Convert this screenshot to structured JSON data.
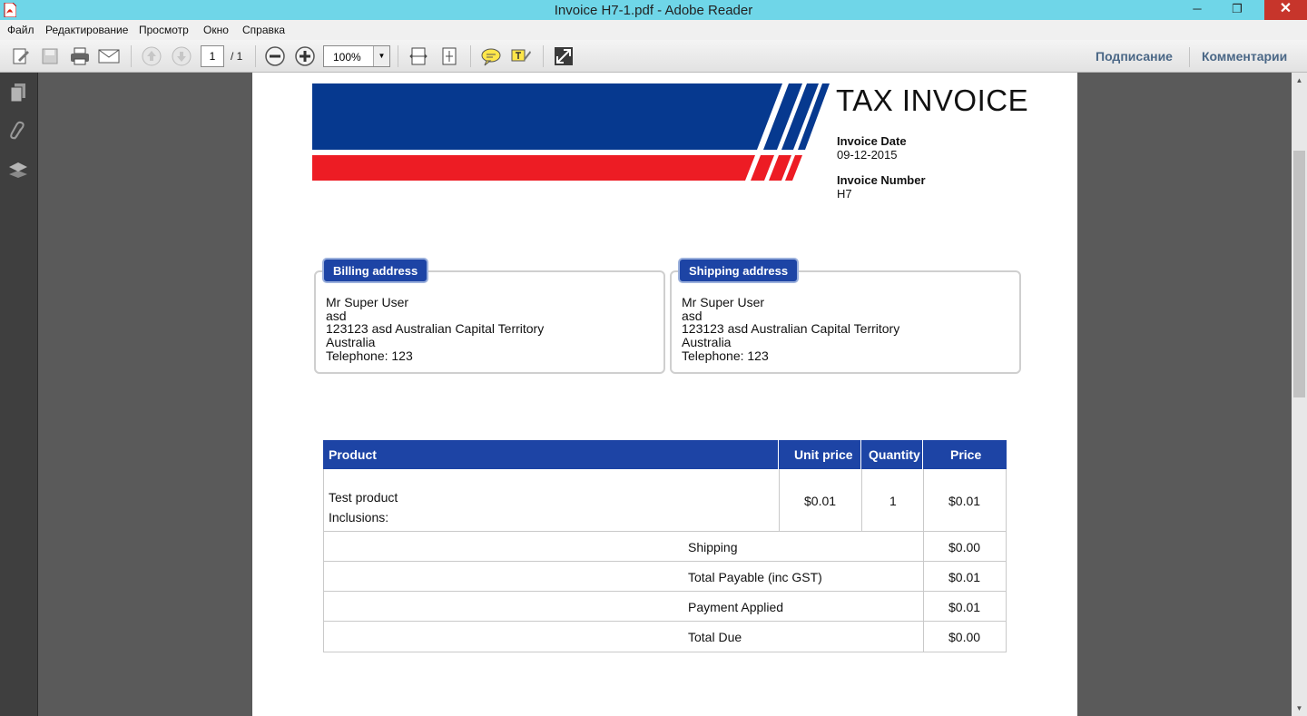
{
  "window": {
    "title": "Invoice H7-1.pdf - Adobe Reader",
    "restore_glyph": "❐",
    "minimize_glyph": "─",
    "close_glyph": "✕"
  },
  "menu": {
    "file": "Файл",
    "edit": "Редактирование",
    "view": "Просмотр",
    "window": "Окно",
    "help": "Справка"
  },
  "toolbar": {
    "page_current": "1",
    "page_total": "/ 1",
    "zoom": "100%",
    "sign_label": "Подписание",
    "comment_label": "Комментарии"
  },
  "colors": {
    "accent_blue": "#1d44a5",
    "banner_blue": "#06398f",
    "banner_red": "#ed1c24",
    "titlebar": "#6fd6e8"
  },
  "invoice": {
    "title": "TAX INVOICE",
    "date_label": "Invoice Date",
    "date_value": "09-12-2015",
    "number_label": "Invoice Number",
    "number_value": "H7",
    "billing": {
      "heading": "Billing address",
      "name": "Mr Super User",
      "line1": "asd",
      "line2": "123123 asd Australian Capital Territory",
      "country": "Australia",
      "phone": "Telephone: 123"
    },
    "shipping": {
      "heading": "Shipping address",
      "name": "Mr Super User",
      "line1": "asd",
      "line2": "123123 asd Australian Capital Territory",
      "country": "Australia",
      "phone": "Telephone: 123"
    },
    "table": {
      "headers": [
        "Product",
        "Unit price",
        "Quantity",
        "Price"
      ],
      "item": {
        "product": "Test product",
        "inclusions": "Inclusions:",
        "unit_price": "$0.01",
        "quantity": "1",
        "price": "$0.01"
      },
      "totals": [
        {
          "label": "Shipping",
          "value": "$0.00"
        },
        {
          "label": "Total Payable (inc GST)",
          "value": "$0.01"
        },
        {
          "label": "Payment Applied",
          "value": "$0.01"
        },
        {
          "label": "Total Due",
          "value": "$0.00"
        }
      ]
    }
  }
}
